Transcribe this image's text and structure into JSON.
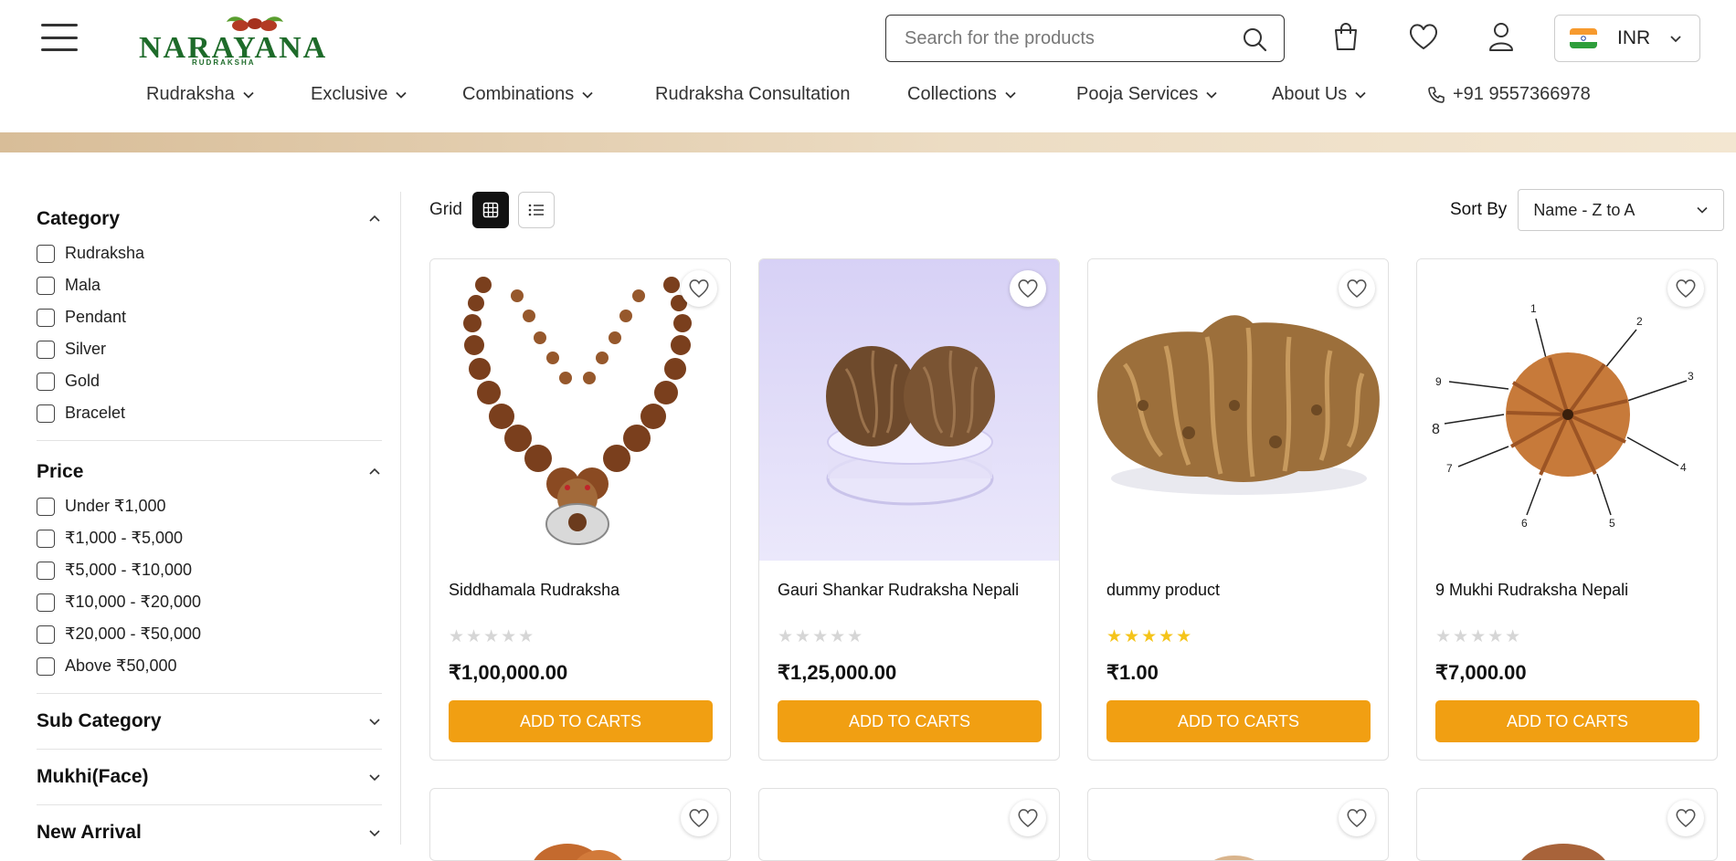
{
  "brand": {
    "name": "NARAYANA",
    "sub": "RUDRAKSHA"
  },
  "search": {
    "placeholder": "Search for the products"
  },
  "currency": {
    "code": "INR"
  },
  "nav": [
    {
      "label": "Rudraksha",
      "dropdown": true
    },
    {
      "label": "Exclusive",
      "dropdown": true
    },
    {
      "label": "Combinations",
      "dropdown": true
    },
    {
      "label": "Rudraksha Consultation",
      "dropdown": false
    },
    {
      "label": "Collections",
      "dropdown": true
    },
    {
      "label": "Pooja Services",
      "dropdown": true
    },
    {
      "label": "About Us",
      "dropdown": true
    },
    {
      "label": "+91 9557366978",
      "icon": "phone-icon"
    }
  ],
  "filters": {
    "category": {
      "title": "Category",
      "options": [
        "Rudraksha",
        "Mala",
        "Pendant",
        "Silver",
        "Gold",
        "Bracelet"
      ]
    },
    "price": {
      "title": "Price",
      "options": [
        "Under ₹1,000",
        "₹1,000 - ₹5,000",
        "₹5,000 - ₹10,000",
        "₹10,000 - ₹20,000",
        "₹20,000 - ₹50,000",
        "Above ₹50,000"
      ]
    },
    "sub_category": {
      "title": "Sub Category"
    },
    "mukhi": {
      "title": "Mukhi(Face)"
    },
    "new_arrival": {
      "title": "New Arrival"
    }
  },
  "toolbar": {
    "grid_label": "Grid",
    "sort_label": "Sort By",
    "sort_value": "Name - Z to A"
  },
  "products": [
    {
      "name": "Siddhamala Rudraksha",
      "rating": 0,
      "price": "₹1,00,000.00",
      "cart_label": "ADD TO CARTS"
    },
    {
      "name": "Gauri Shankar Rudraksha Nepali",
      "rating": 0,
      "price": "₹1,25,000.00",
      "cart_label": "ADD TO CARTS"
    },
    {
      "name": "dummy product",
      "rating": 5,
      "price": "₹1.00",
      "cart_label": "ADD TO CARTS"
    },
    {
      "name": "9 Mukhi Rudraksha Nepali",
      "rating": 0,
      "price": "₹7,000.00",
      "cart_label": "ADD TO CARTS"
    }
  ],
  "diagram_numbers": [
    "1",
    "2",
    "3",
    "4",
    "5",
    "6",
    "7",
    "8",
    "9"
  ],
  "colors": {
    "accent": "#f19f12",
    "brand_green": "#1e6b2a",
    "star_gold": "#f5c41a"
  }
}
